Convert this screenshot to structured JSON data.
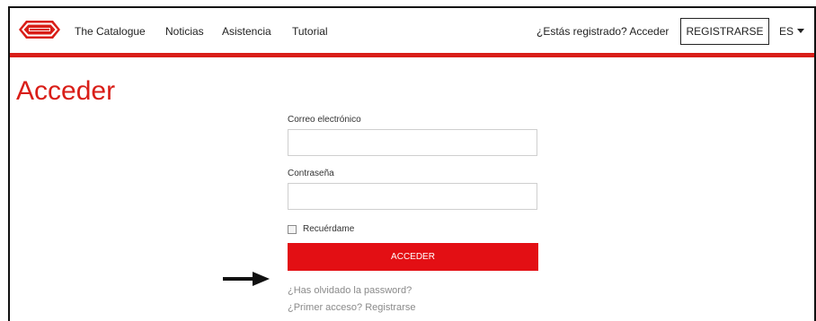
{
  "nav": {
    "logo_alt": "SILCA",
    "links": [
      "The Catalogue",
      "Noticias",
      "Asistencia",
      "Tutorial"
    ],
    "login_text": "¿Estás registrado? Acceder",
    "register_label": "REGISTRARSE",
    "language": "ES",
    "brand_color": "#d91e18"
  },
  "page": {
    "title": "Acceder"
  },
  "form": {
    "email_label": "Correo electrónico",
    "email_value": "",
    "password_label": "Contraseña",
    "password_value": "",
    "remember_label": "Recuérdame",
    "remember_checked": false,
    "submit_label": "ACCEDER",
    "submit_color": "#e30f14",
    "forgot_link": "¿Has olvidado la password?",
    "first_access_link": "¿Primer acceso? Registrarse"
  },
  "annotation": {
    "icon": "arrow-right-icon"
  }
}
